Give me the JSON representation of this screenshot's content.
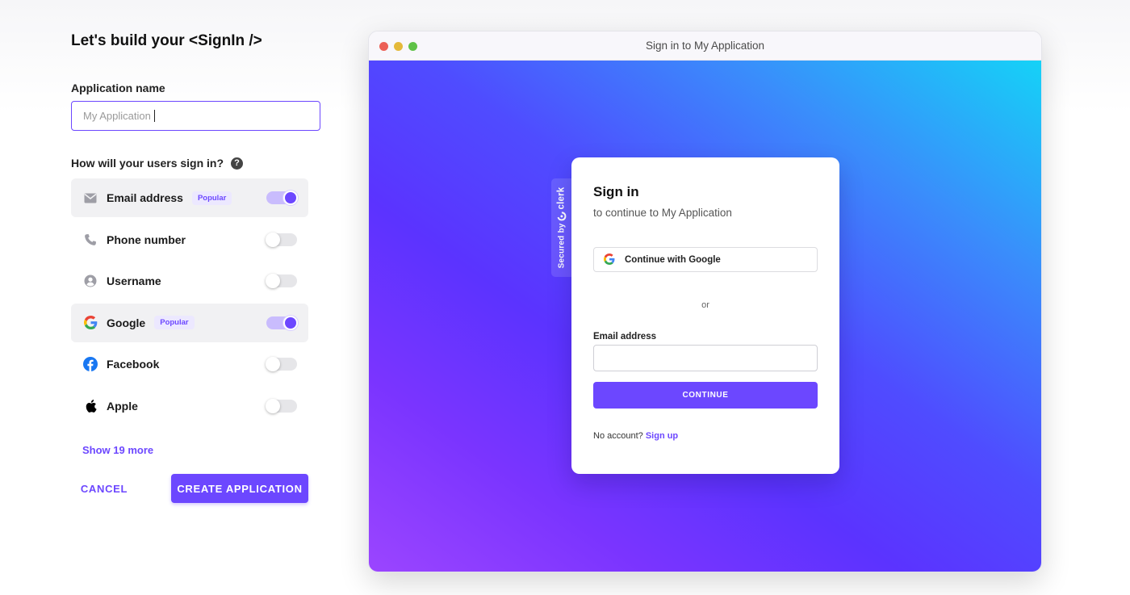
{
  "config": {
    "title": "Let's build your <SignIn />",
    "app_name_label": "Application name",
    "app_name_placeholder": "My Application",
    "app_name_value": "",
    "question": "How will your users sign in?",
    "help_icon": "question-circle-icon",
    "options": [
      {
        "label": "Email address",
        "badge": "Popular",
        "enabled": true,
        "icon": "envelope-icon"
      },
      {
        "label": "Phone number",
        "badge": "",
        "enabled": false,
        "icon": "phone-icon"
      },
      {
        "label": "Username",
        "badge": "",
        "enabled": false,
        "icon": "user-circle-icon"
      },
      {
        "label": "Google",
        "badge": "Popular",
        "enabled": true,
        "icon": "google-icon"
      },
      {
        "label": "Facebook",
        "badge": "",
        "enabled": false,
        "icon": "facebook-icon"
      },
      {
        "label": "Apple",
        "badge": "",
        "enabled": false,
        "icon": "apple-icon"
      }
    ],
    "show_more": "Show 19 more",
    "cancel": "CANCEL",
    "create": "CREATE APPLICATION"
  },
  "preview": {
    "window_title": "Sign in to My Application",
    "secured_by": "Secured by",
    "brand": "clerk",
    "card": {
      "title": "Sign in",
      "subtitle": "to continue to My Application",
      "google_button": "Continue with Google",
      "divider": "or",
      "email_label": "Email address",
      "email_value": "",
      "continue_button": "CONTINUE",
      "no_account": "No account?",
      "sign_up": "Sign up"
    }
  },
  "colors": {
    "accent": "#6c47ff",
    "gradient": [
      "#15d2f7",
      "#4f4cff",
      "#9b45ff"
    ]
  }
}
